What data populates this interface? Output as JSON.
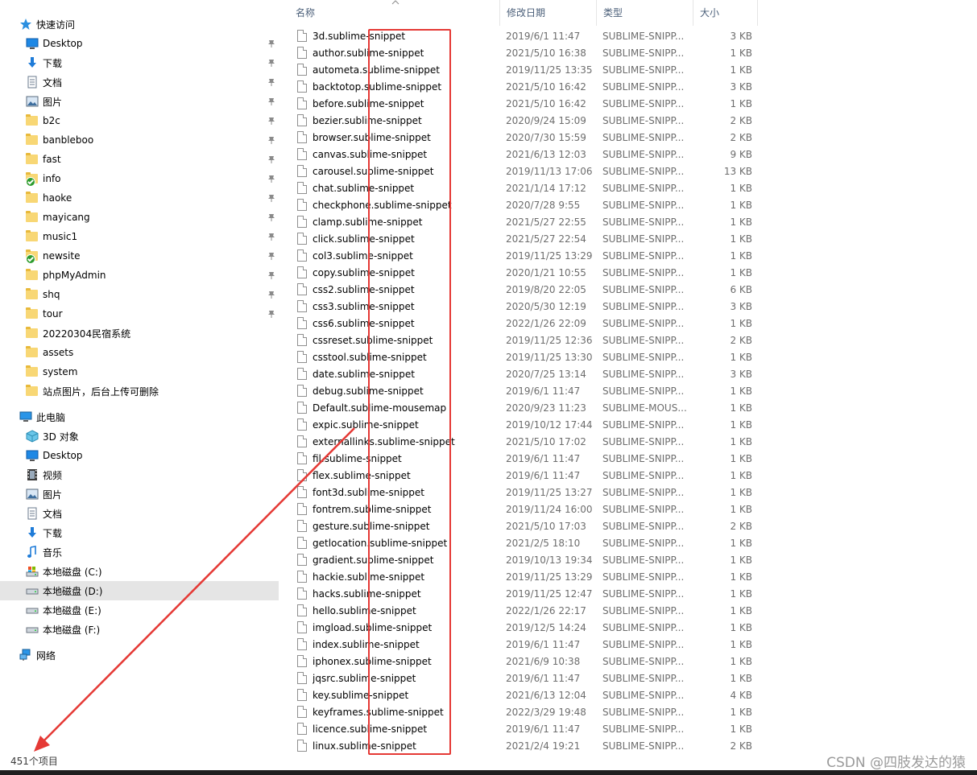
{
  "sidebar": {
    "items": [
      {
        "label": "快速访问",
        "icon": "star-icon",
        "pinned": false,
        "indent": 0
      },
      {
        "label": "Desktop",
        "icon": "desktop-icon",
        "pinned": true,
        "indent": 1
      },
      {
        "label": "下载",
        "icon": "download-icon",
        "pinned": true,
        "indent": 1
      },
      {
        "label": "文档",
        "icon": "document-icon",
        "pinned": true,
        "indent": 1
      },
      {
        "label": "图片",
        "icon": "pictures-icon",
        "pinned": true,
        "indent": 1
      },
      {
        "label": "b2c",
        "icon": "folder-icon",
        "pinned": true,
        "indent": 1
      },
      {
        "label": "banbleboo",
        "icon": "folder-icon",
        "pinned": true,
        "indent": 1
      },
      {
        "label": "fast",
        "icon": "folder-icon",
        "pinned": true,
        "indent": 1
      },
      {
        "label": "info",
        "icon": "folder-synced-icon",
        "pinned": true,
        "indent": 1
      },
      {
        "label": "haoke",
        "icon": "folder-icon",
        "pinned": true,
        "indent": 1
      },
      {
        "label": "mayicang",
        "icon": "folder-icon",
        "pinned": true,
        "indent": 1
      },
      {
        "label": "music1",
        "icon": "folder-icon",
        "pinned": true,
        "indent": 1
      },
      {
        "label": "newsite",
        "icon": "folder-synced-icon",
        "pinned": true,
        "indent": 1
      },
      {
        "label": "phpMyAdmin",
        "icon": "folder-icon",
        "pinned": true,
        "indent": 1
      },
      {
        "label": "shq",
        "icon": "folder-icon",
        "pinned": true,
        "indent": 1
      },
      {
        "label": "tour",
        "icon": "folder-icon",
        "pinned": true,
        "indent": 1
      },
      {
        "label": "20220304民宿系统",
        "icon": "folder-icon",
        "pinned": false,
        "indent": 1
      },
      {
        "label": "assets",
        "icon": "folder-icon",
        "pinned": false,
        "indent": 1
      },
      {
        "label": "system",
        "icon": "folder-icon",
        "pinned": false,
        "indent": 1
      },
      {
        "label": "站点图片，后台上传可删除",
        "icon": "folder-icon",
        "pinned": false,
        "indent": 1
      },
      {
        "label": "此电脑",
        "icon": "computer-icon",
        "pinned": false,
        "indent": 0
      },
      {
        "label": "3D 对象",
        "icon": "3d-objects-icon",
        "pinned": false,
        "indent": 1
      },
      {
        "label": "Desktop",
        "icon": "desktop-icon",
        "pinned": false,
        "indent": 1
      },
      {
        "label": "视频",
        "icon": "video-icon",
        "pinned": false,
        "indent": 1
      },
      {
        "label": "图片",
        "icon": "pictures-icon",
        "pinned": false,
        "indent": 1
      },
      {
        "label": "文档",
        "icon": "document-icon",
        "pinned": false,
        "indent": 1
      },
      {
        "label": "下载",
        "icon": "download-icon",
        "pinned": false,
        "indent": 1
      },
      {
        "label": "音乐",
        "icon": "music-icon",
        "pinned": false,
        "indent": 1
      },
      {
        "label": "本地磁盘 (C:)",
        "icon": "system-drive-icon",
        "pinned": false,
        "indent": 1
      },
      {
        "label": "本地磁盘 (D:)",
        "icon": "drive-icon",
        "pinned": false,
        "indent": 1,
        "selected": true
      },
      {
        "label": "本地磁盘 (E:)",
        "icon": "drive-icon",
        "pinned": false,
        "indent": 1
      },
      {
        "label": "本地磁盘 (F:)",
        "icon": "drive-icon",
        "pinned": false,
        "indent": 1
      },
      {
        "label": "网络",
        "icon": "network-icon",
        "pinned": false,
        "indent": 0
      }
    ]
  },
  "columns": {
    "name": "名称",
    "date": "修改日期",
    "type": "类型",
    "size": "大小"
  },
  "files": [
    {
      "name": "3d.sublime-snippet",
      "date": "2019/6/1 11:47",
      "type": "SUBLIME-SNIPP...",
      "size": "3 KB"
    },
    {
      "name": "author.sublime-snippet",
      "date": "2021/5/10 16:38",
      "type": "SUBLIME-SNIPP...",
      "size": "1 KB"
    },
    {
      "name": "autometa.sublime-snippet",
      "date": "2019/11/25 13:35",
      "type": "SUBLIME-SNIPP...",
      "size": "1 KB"
    },
    {
      "name": "backtotop.sublime-snippet",
      "date": "2021/5/10 16:42",
      "type": "SUBLIME-SNIPP...",
      "size": "3 KB"
    },
    {
      "name": "before.sublime-snippet",
      "date": "2021/5/10 16:42",
      "type": "SUBLIME-SNIPP...",
      "size": "1 KB"
    },
    {
      "name": "bezier.sublime-snippet",
      "date": "2020/9/24 15:09",
      "type": "SUBLIME-SNIPP...",
      "size": "2 KB"
    },
    {
      "name": "browser.sublime-snippet",
      "date": "2020/7/30 15:59",
      "type": "SUBLIME-SNIPP...",
      "size": "2 KB"
    },
    {
      "name": "canvas.sublime-snippet",
      "date": "2021/6/13 12:03",
      "type": "SUBLIME-SNIPP...",
      "size": "9 KB"
    },
    {
      "name": "carousel.sublime-snippet",
      "date": "2019/11/13 17:06",
      "type": "SUBLIME-SNIPP...",
      "size": "13 KB"
    },
    {
      "name": "chat.sublime-snippet",
      "date": "2021/1/14 17:12",
      "type": "SUBLIME-SNIPP...",
      "size": "1 KB"
    },
    {
      "name": "checkphone.sublime-snippet",
      "date": "2020/7/28 9:55",
      "type": "SUBLIME-SNIPP...",
      "size": "1 KB"
    },
    {
      "name": "clamp.sublime-snippet",
      "date": "2021/5/27 22:55",
      "type": "SUBLIME-SNIPP...",
      "size": "1 KB"
    },
    {
      "name": "click.sublime-snippet",
      "date": "2021/5/27 22:54",
      "type": "SUBLIME-SNIPP...",
      "size": "1 KB"
    },
    {
      "name": "col3.sublime-snippet",
      "date": "2019/11/25 13:29",
      "type": "SUBLIME-SNIPP...",
      "size": "1 KB"
    },
    {
      "name": "copy.sublime-snippet",
      "date": "2020/1/21 10:55",
      "type": "SUBLIME-SNIPP...",
      "size": "1 KB"
    },
    {
      "name": "css2.sublime-snippet",
      "date": "2019/8/20 22:05",
      "type": "SUBLIME-SNIPP...",
      "size": "6 KB"
    },
    {
      "name": "css3.sublime-snippet",
      "date": "2020/5/30 12:19",
      "type": "SUBLIME-SNIPP...",
      "size": "3 KB"
    },
    {
      "name": "css6.sublime-snippet",
      "date": "2022/1/26 22:09",
      "type": "SUBLIME-SNIPP...",
      "size": "1 KB"
    },
    {
      "name": "cssreset.sublime-snippet",
      "date": "2019/11/25 12:36",
      "type": "SUBLIME-SNIPP...",
      "size": "2 KB"
    },
    {
      "name": "csstool.sublime-snippet",
      "date": "2019/11/25 13:30",
      "type": "SUBLIME-SNIPP...",
      "size": "1 KB"
    },
    {
      "name": "date.sublime-snippet",
      "date": "2020/7/25 13:14",
      "type": "SUBLIME-SNIPP...",
      "size": "3 KB"
    },
    {
      "name": "debug.sublime-snippet",
      "date": "2019/6/1 11:47",
      "type": "SUBLIME-SNIPP...",
      "size": "1 KB"
    },
    {
      "name": "Default.sublime-mousemap",
      "date": "2020/9/23 11:23",
      "type": "SUBLIME-MOUS...",
      "size": "1 KB"
    },
    {
      "name": "expic.sublime-snippet",
      "date": "2019/10/12 17:44",
      "type": "SUBLIME-SNIPP...",
      "size": "1 KB"
    },
    {
      "name": "externallinks.sublime-snippet",
      "date": "2021/5/10 17:02",
      "type": "SUBLIME-SNIPP...",
      "size": "1 KB"
    },
    {
      "name": "fil.sublime-snippet",
      "date": "2019/6/1 11:47",
      "type": "SUBLIME-SNIPP...",
      "size": "1 KB"
    },
    {
      "name": "flex.sublime-snippet",
      "date": "2019/6/1 11:47",
      "type": "SUBLIME-SNIPP...",
      "size": "1 KB"
    },
    {
      "name": "font3d.sublime-snippet",
      "date": "2019/11/25 13:27",
      "type": "SUBLIME-SNIPP...",
      "size": "1 KB"
    },
    {
      "name": "fontrem.sublime-snippet",
      "date": "2019/11/24 16:00",
      "type": "SUBLIME-SNIPP...",
      "size": "1 KB"
    },
    {
      "name": "gesture.sublime-snippet",
      "date": "2021/5/10 17:03",
      "type": "SUBLIME-SNIPP...",
      "size": "2 KB"
    },
    {
      "name": "getlocation.sublime-snippet",
      "date": "2021/2/5 18:10",
      "type": "SUBLIME-SNIPP...",
      "size": "1 KB"
    },
    {
      "name": "gradient.sublime-snippet",
      "date": "2019/10/13 19:34",
      "type": "SUBLIME-SNIPP...",
      "size": "1 KB"
    },
    {
      "name": "hackie.sublime-snippet",
      "date": "2019/11/25 13:29",
      "type": "SUBLIME-SNIPP...",
      "size": "1 KB"
    },
    {
      "name": "hacks.sublime-snippet",
      "date": "2019/11/25 12:47",
      "type": "SUBLIME-SNIPP...",
      "size": "1 KB"
    },
    {
      "name": "hello.sublime-snippet",
      "date": "2022/1/26 22:17",
      "type": "SUBLIME-SNIPP...",
      "size": "1 KB"
    },
    {
      "name": "imgload.sublime-snippet",
      "date": "2019/12/5 14:24",
      "type": "SUBLIME-SNIPP...",
      "size": "1 KB"
    },
    {
      "name": "index.sublime-snippet",
      "date": "2019/6/1 11:47",
      "type": "SUBLIME-SNIPP...",
      "size": "1 KB"
    },
    {
      "name": "iphonex.sublime-snippet",
      "date": "2021/6/9 10:38",
      "type": "SUBLIME-SNIPP...",
      "size": "1 KB"
    },
    {
      "name": "jqsrc.sublime-snippet",
      "date": "2019/6/1 11:47",
      "type": "SUBLIME-SNIPP...",
      "size": "1 KB"
    },
    {
      "name": "key.sublime-snippet",
      "date": "2021/6/13 12:04",
      "type": "SUBLIME-SNIPP...",
      "size": "4 KB"
    },
    {
      "name": "keyframes.sublime-snippet",
      "date": "2022/3/29 19:48",
      "type": "SUBLIME-SNIPP...",
      "size": "1 KB"
    },
    {
      "name": "licence.sublime-snippet",
      "date": "2019/6/1 11:47",
      "type": "SUBLIME-SNIPP...",
      "size": "1 KB"
    },
    {
      "name": "linux.sublime-snippet",
      "date": "2021/2/4 19:21",
      "type": "SUBLIME-SNIPP...",
      "size": "2 KB"
    }
  ],
  "status": {
    "item_count": "451个项目"
  },
  "watermark": "CSDN @四肢发达的猿",
  "colors": {
    "annotation": "#e53935",
    "selection": "#e5e5e5",
    "header_text": "#4c607a",
    "detail_text": "#6d6d6d"
  }
}
